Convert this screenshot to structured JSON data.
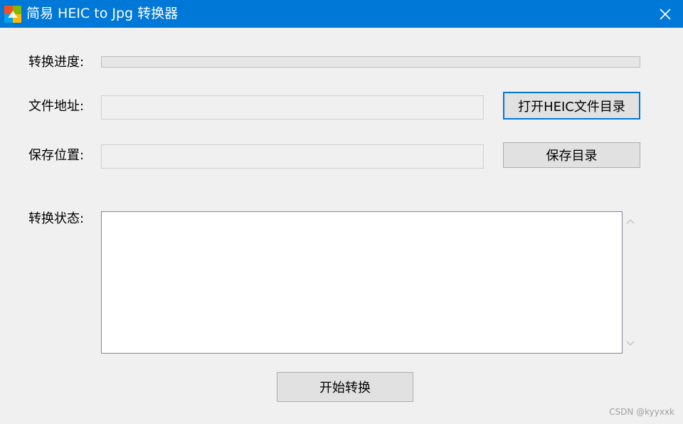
{
  "window": {
    "title": "简易 HEIC to Jpg 转换器",
    "titlebar_color": "#0078d7",
    "close_icon": "close-icon"
  },
  "progress": {
    "label": "转换进度:",
    "value": 0
  },
  "file_path": {
    "label": "文件地址:",
    "value": "",
    "button_label": "打开HEIC文件目录"
  },
  "save_path": {
    "label": "保存位置:",
    "value": "",
    "button_label": "保存目录"
  },
  "status": {
    "label": "转换状态:",
    "text": ""
  },
  "start_button_label": "开始转换",
  "watermark": "CSDN @kyyxxk"
}
